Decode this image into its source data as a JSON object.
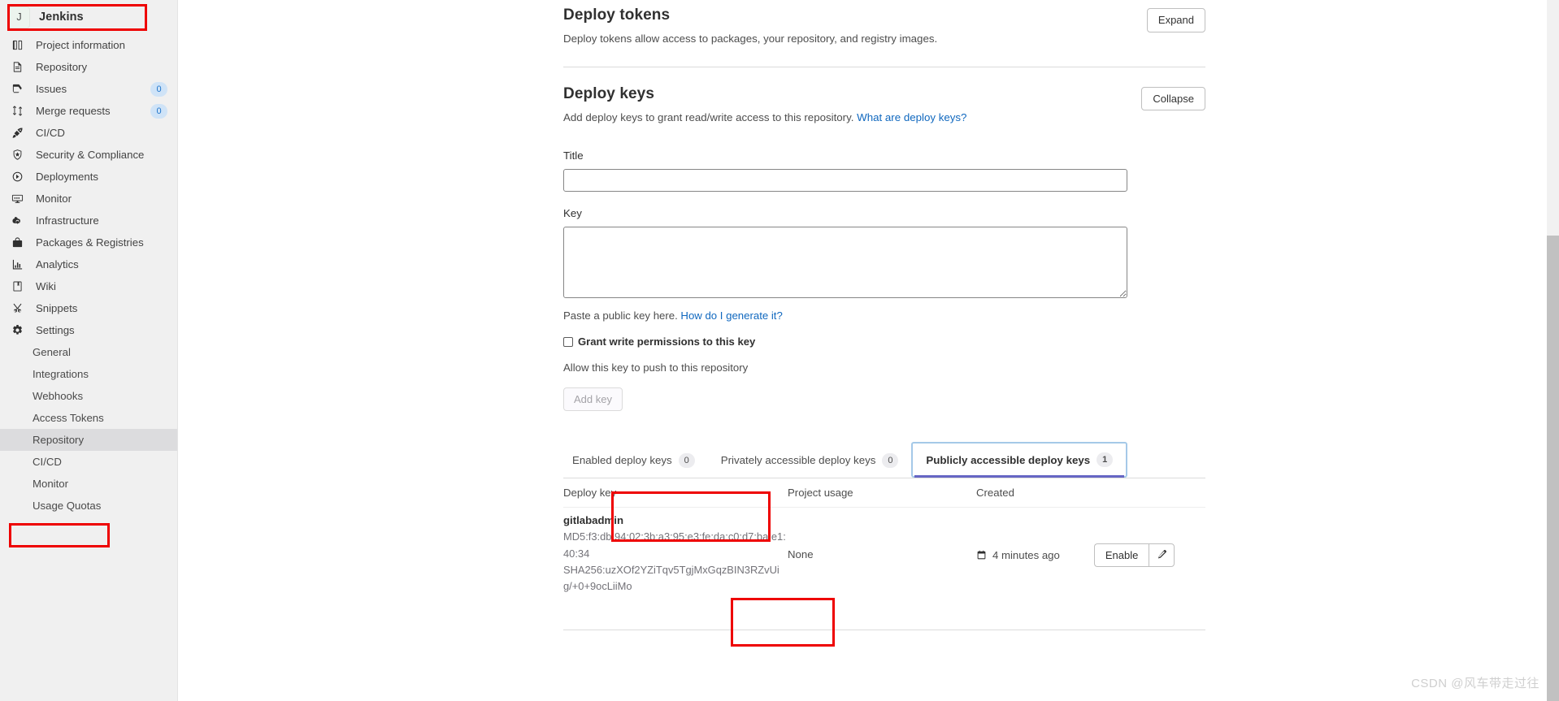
{
  "sidebar": {
    "project": {
      "initial": "J",
      "name": "Jenkins"
    },
    "items": [
      {
        "label": "Project information",
        "icon": "project-information-icon",
        "badge": null
      },
      {
        "label": "Repository",
        "icon": "repository-icon",
        "badge": null
      },
      {
        "label": "Issues",
        "icon": "issues-icon",
        "badge": "0"
      },
      {
        "label": "Merge requests",
        "icon": "merge-requests-icon",
        "badge": "0"
      },
      {
        "label": "CI/CD",
        "icon": "rocket-icon",
        "badge": null
      },
      {
        "label": "Security & Compliance",
        "icon": "shield-icon",
        "badge": null
      },
      {
        "label": "Deployments",
        "icon": "deployments-icon",
        "badge": null
      },
      {
        "label": "Monitor",
        "icon": "monitor-icon",
        "badge": null
      },
      {
        "label": "Infrastructure",
        "icon": "cloud-gear-icon",
        "badge": null
      },
      {
        "label": "Packages & Registries",
        "icon": "package-icon",
        "badge": null
      },
      {
        "label": "Analytics",
        "icon": "analytics-icon",
        "badge": null
      },
      {
        "label": "Wiki",
        "icon": "wiki-icon",
        "badge": null
      },
      {
        "label": "Snippets",
        "icon": "snippets-icon",
        "badge": null
      },
      {
        "label": "Settings",
        "icon": "gear-icon",
        "badge": null
      }
    ],
    "settings_subitems": [
      {
        "label": "General",
        "active": false
      },
      {
        "label": "Integrations",
        "active": false
      },
      {
        "label": "Webhooks",
        "active": false
      },
      {
        "label": "Access Tokens",
        "active": false
      },
      {
        "label": "Repository",
        "active": true
      },
      {
        "label": "CI/CD",
        "active": false
      },
      {
        "label": "Monitor",
        "active": false
      },
      {
        "label": "Usage Quotas",
        "active": false
      }
    ]
  },
  "deploy_tokens": {
    "title": "Deploy tokens",
    "description": "Deploy tokens allow access to packages, your repository, and registry images.",
    "toggle_label": "Expand"
  },
  "deploy_keys": {
    "title": "Deploy keys",
    "description_prefix": "Add deploy keys to grant read/write access to this repository.",
    "description_link": "What are deploy keys?",
    "toggle_label": "Collapse",
    "form": {
      "title_label": "Title",
      "title_value": "",
      "title_placeholder": "",
      "key_label": "Key",
      "key_value": "",
      "key_placeholder": "",
      "key_hint_prefix": "Paste a public key here.",
      "key_hint_link": "How do I generate it?",
      "write_checkbox_label": "Grant write permissions to this key",
      "write_checkbox_checked": false,
      "write_help_text": "Allow this key to push to this repository",
      "submit_label": "Add key",
      "submit_disabled": true
    },
    "tabs": [
      {
        "label": "Enabled deploy keys",
        "count": "0",
        "active": false
      },
      {
        "label": "Privately accessible deploy keys",
        "count": "0",
        "active": false
      },
      {
        "label": "Publicly accessible deploy keys",
        "count": "1",
        "active": true
      }
    ],
    "table": {
      "columns": [
        "Deploy key",
        "Project usage",
        "Created"
      ],
      "rows": [
        {
          "title": "gitlabadmin",
          "fingerprint_md5": "MD5:f3:db:94:02:3b:a3:95:e3:fe:da:c0:d7:ba:e1:40:34",
          "fingerprint_sha256": "SHA256:uzXOf2YZiTqv5TgjMxGqzBIN3RZvUig/+0+9ocLiiMo",
          "project_usage": "None",
          "created": "4 minutes ago",
          "action_label": "Enable",
          "edit_icon": "pencil-icon"
        }
      ]
    }
  },
  "watermark": "CSDN @风车带走过往",
  "colors": {
    "sidebar_bg": "#f0f0f0",
    "annotation_red": "#ee0000",
    "link_blue": "#1068bf",
    "tab_focus_blue": "#a5c9e8",
    "tab_underline": "#6666c4",
    "badge_blue_bg": "#cfe3f7",
    "badge_blue_text": "#1f75cb",
    "active_subitem_bg": "#dcdcde"
  }
}
